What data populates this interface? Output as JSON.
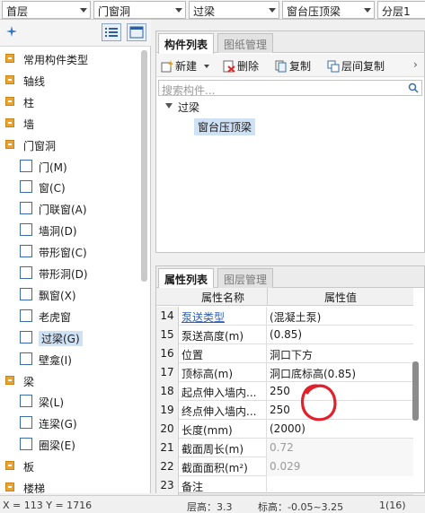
{
  "topbar": {
    "floor": "首层",
    "category": "门窗洞",
    "component_type": "过梁",
    "component": "窗台压顶梁",
    "layer": "分层1"
  },
  "tree": {
    "items": [
      {
        "label": "常用构件类型",
        "level": 0,
        "icon": "folder-icon"
      },
      {
        "label": "轴线",
        "level": 0,
        "icon": "folder-icon"
      },
      {
        "label": "柱",
        "level": 0,
        "icon": "folder-icon"
      },
      {
        "label": "墙",
        "level": 0,
        "icon": "folder-icon"
      },
      {
        "label": "门窗洞",
        "level": 0,
        "icon": "folder-open-icon"
      },
      {
        "label": "门(M)",
        "level": 1,
        "icon": "door-icon"
      },
      {
        "label": "窗(C)",
        "level": 1,
        "icon": "window-icon"
      },
      {
        "label": "门联窗(A)",
        "level": 1,
        "icon": "door-window-icon"
      },
      {
        "label": "墙洞(D)",
        "level": 1,
        "icon": "wall-hole-icon"
      },
      {
        "label": "带形窗(C)",
        "level": 1,
        "icon": "strip-window-icon"
      },
      {
        "label": "带形洞(D)",
        "level": 1,
        "icon": "strip-hole-icon"
      },
      {
        "label": "飘窗(X)",
        "level": 1,
        "icon": "bay-window-icon"
      },
      {
        "label": "老虎窗",
        "level": 1,
        "icon": "dormer-window-icon"
      },
      {
        "label": "过梁(G)",
        "level": 1,
        "icon": "lintel-icon",
        "selected": true
      },
      {
        "label": "壁龛(I)",
        "level": 1,
        "icon": "niche-icon"
      },
      {
        "label": "梁",
        "level": 0,
        "icon": "folder-open-icon"
      },
      {
        "label": "梁(L)",
        "level": 1,
        "icon": "beam-icon"
      },
      {
        "label": "连梁(G)",
        "level": 1,
        "icon": "link-beam-icon"
      },
      {
        "label": "圈梁(E)",
        "level": 1,
        "icon": "ring-beam-icon"
      },
      {
        "label": "板",
        "level": 0,
        "icon": "folder-icon"
      },
      {
        "label": "楼梯",
        "level": 0,
        "icon": "folder-icon"
      }
    ]
  },
  "component_panel": {
    "tabs": [
      "构件列表",
      "图纸管理"
    ],
    "actions": {
      "new": "新建",
      "delete": "删除",
      "copy": "复制",
      "floor_copy": "层间复制"
    },
    "search_placeholder": "搜索构件...",
    "group": "过梁",
    "item": "窗台压顶梁"
  },
  "property_panel": {
    "tabs": [
      "属性列表",
      "图层管理"
    ],
    "headers": {
      "name": "属性名称",
      "value": "属性值"
    },
    "rows": [
      {
        "num": "14",
        "name": "泵送类型",
        "value": "(混凝土泵)",
        "link": true
      },
      {
        "num": "15",
        "name": "泵送高度(m)",
        "value": "(0.85)"
      },
      {
        "num": "16",
        "name": "位置",
        "value": "洞口下方"
      },
      {
        "num": "17",
        "name": "顶标高(m)",
        "value": "洞口底标高(0.85)"
      },
      {
        "num": "18",
        "name": "起点伸入墙内...",
        "value": "250"
      },
      {
        "num": "19",
        "name": "终点伸入墙内...",
        "value": "250"
      },
      {
        "num": "20",
        "name": "长度(mm)",
        "value": "(2000)"
      },
      {
        "num": "21",
        "name": "截面周长(m)",
        "value": "0.72",
        "gray": true
      },
      {
        "num": "22",
        "name": "截面面积(m²)",
        "value": "0.029",
        "gray": true
      },
      {
        "num": "23",
        "name": "备注",
        "value": ""
      }
    ]
  },
  "status": {
    "coords": "X = 113 Y = 1716",
    "floor_height": "层高：3.3",
    "elevation": "标高：-0.05~3.25",
    "page": "1(16)"
  },
  "colors": {
    "annotation_circle": "#e0202a",
    "selection": "#cfe1f5",
    "folder": "#e8a531",
    "link": "#2f5fb3"
  }
}
